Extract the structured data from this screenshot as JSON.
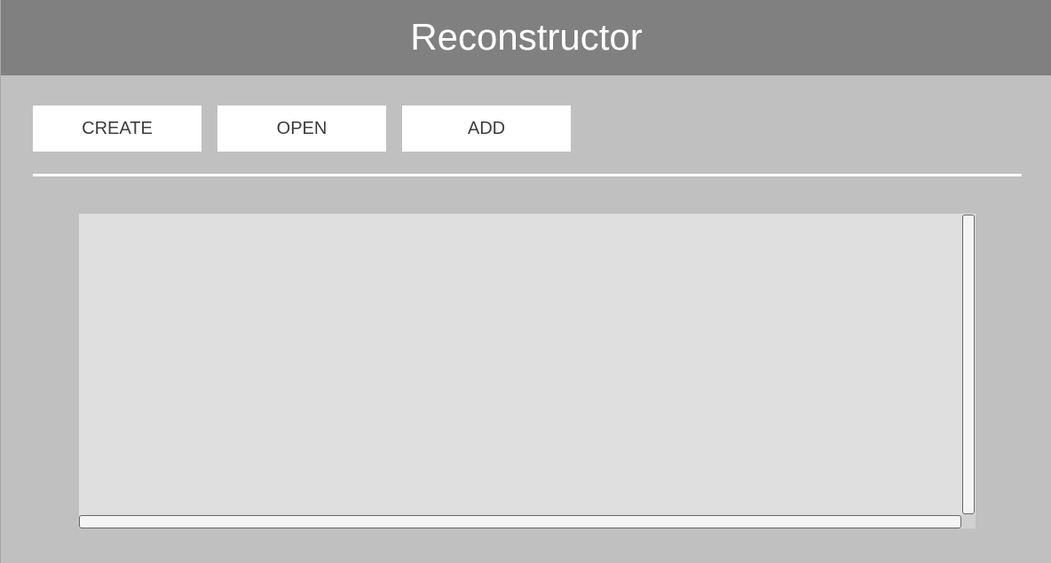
{
  "header": {
    "title": "Reconstructor"
  },
  "toolbar": {
    "create_label": "CREATE",
    "open_label": "OPEN",
    "add_label": "ADD"
  },
  "colors": {
    "header_bg": "#808080",
    "window_bg": "#c0c0c0",
    "button_bg": "#ffffff",
    "content_bg": "#dfdfdf"
  }
}
